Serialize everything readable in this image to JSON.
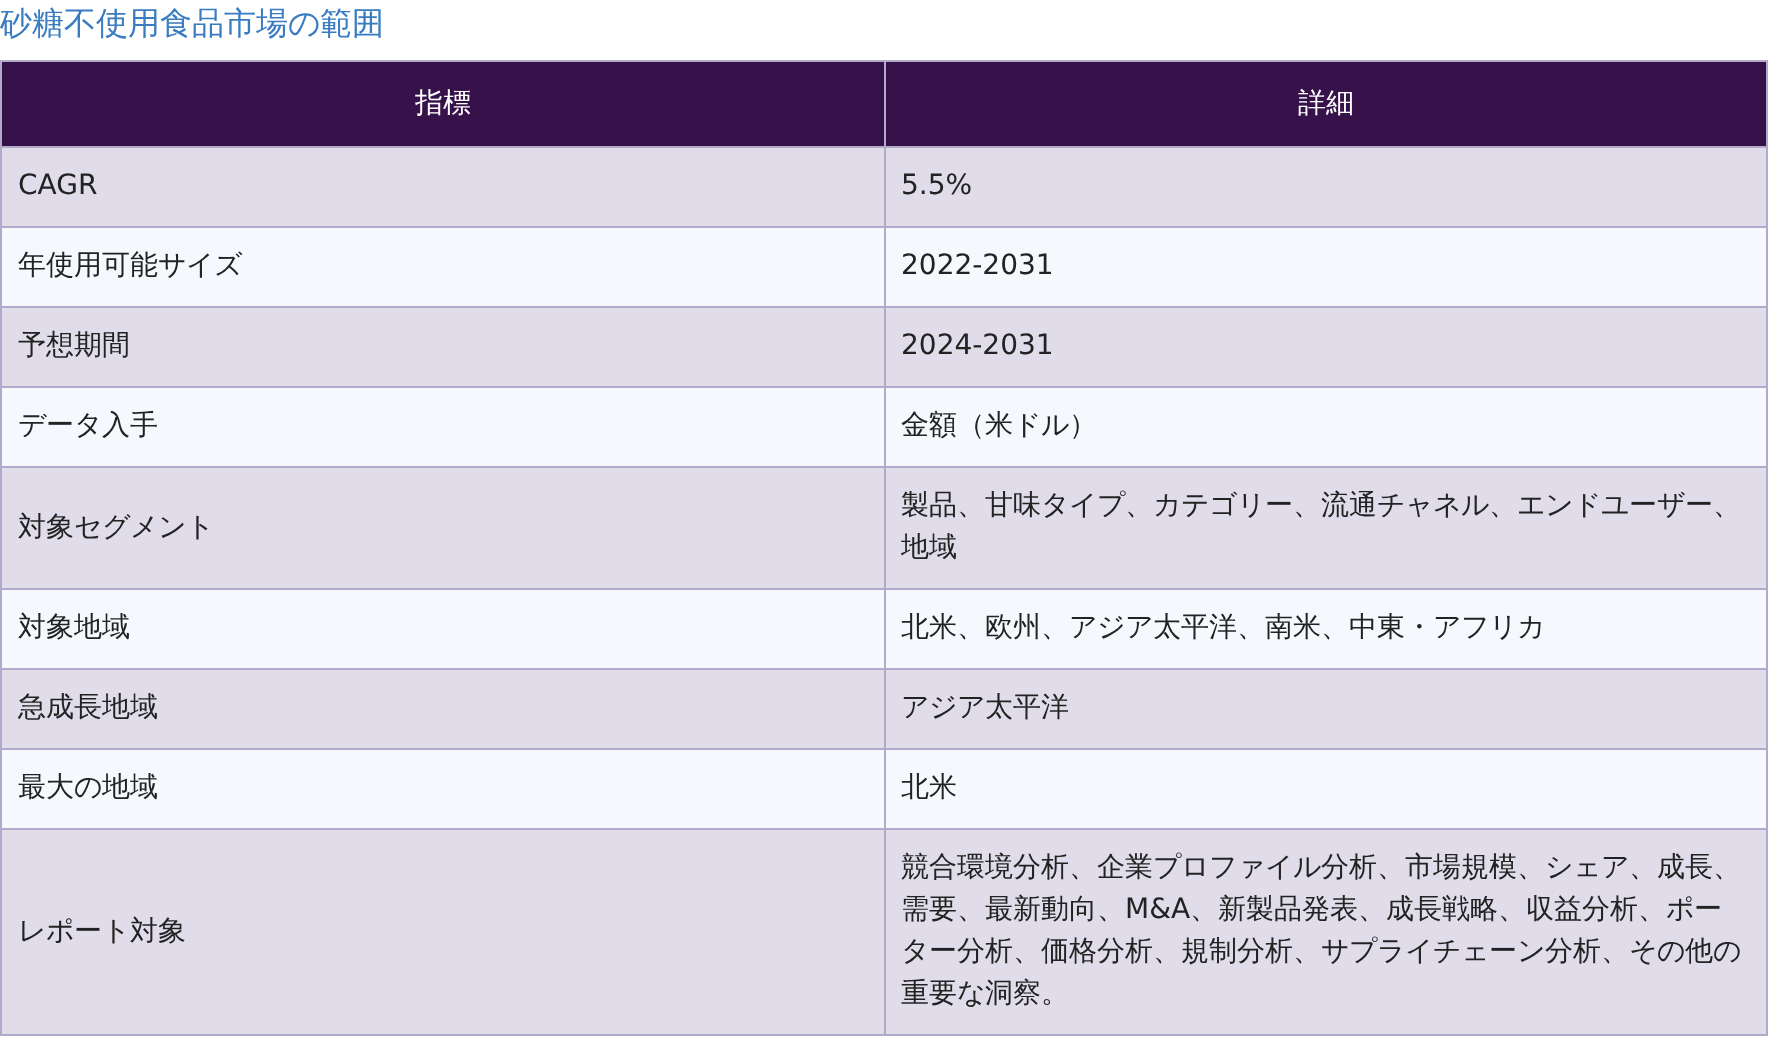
{
  "title": "砂糖不使用食品市場の範囲",
  "table": {
    "columns": [
      "指標",
      "詳細"
    ],
    "rows": [
      [
        "CAGR",
        "5.5%"
      ],
      [
        "年使用可能サイズ",
        "2022-2031"
      ],
      [
        "予想期間",
        "2024-2031"
      ],
      [
        "データ入手",
        "金額（米ドル）"
      ],
      [
        "対象セグメント",
        "製品、甘味タイプ、カテゴリー、流通チャネル、エンドユーザー、地域"
      ],
      [
        "対象地域",
        "北米、欧州、アジア太平洋、南米、中東・アフリカ"
      ],
      [
        "急成長地域",
        "アジア太平洋"
      ],
      [
        "最大の地域",
        "北米"
      ],
      [
        "レポート対象",
        "競合環境分析、企業プロファイル分析、市場規模、シェア、成長、需要、最新動向、M&A、新製品発表、成長戦略、収益分析、ポーター分析、価格分析、規制分析、サプライチェーン分析、その他の重要な洞察。"
      ]
    ]
  }
}
